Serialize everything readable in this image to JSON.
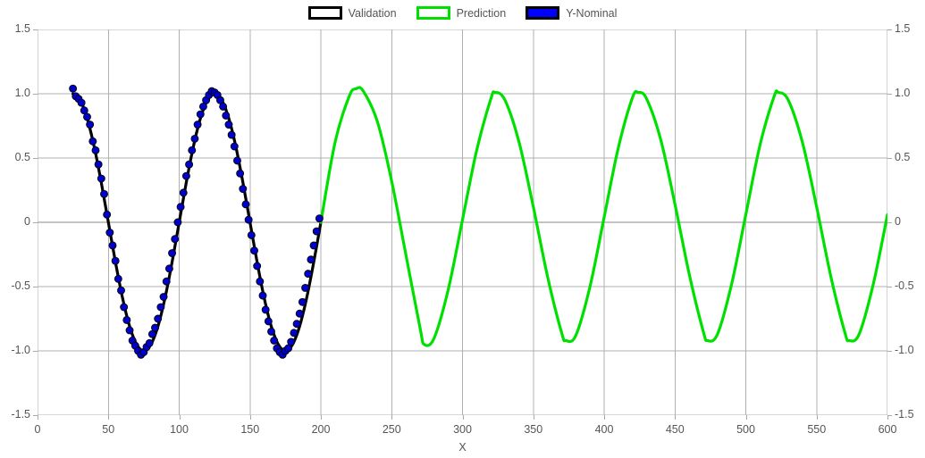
{
  "legend": {
    "position": "top-center",
    "entries": [
      {
        "label": "Validation",
        "swatch": "black-outline-box",
        "color": "#000000"
      },
      {
        "label": "Prediction",
        "swatch": "green-outline-box",
        "color": "#00e000"
      },
      {
        "label": "Y-Nominal",
        "swatch": "blue-filled-box",
        "color": "#0000ff"
      }
    ]
  },
  "axes": {
    "x": {
      "title": "X",
      "ticks": [
        0,
        50,
        100,
        150,
        200,
        250,
        300,
        350,
        400,
        450,
        500,
        550,
        600
      ],
      "tick_labels": [
        "0",
        "50",
        "100",
        "150",
        "200",
        "250",
        "300",
        "350",
        "400",
        "450",
        "500",
        "550",
        "600"
      ],
      "min": 0,
      "max": 600
    },
    "y_left": {
      "title": "",
      "ticks": [
        1.5,
        1.0,
        0.5,
        0,
        -0.5,
        -1.0,
        -1.5
      ],
      "tick_labels": [
        "1.5",
        "1.0",
        "0.5",
        "0",
        "-0.5",
        "-1.0",
        "-1.5"
      ],
      "min": -1.5,
      "max": 1.5
    },
    "y_right": {
      "title": "",
      "ticks": [
        1.5,
        1.0,
        0.5,
        0,
        -0.5,
        -1.0,
        -1.5
      ],
      "tick_labels": [
        "1.5",
        "1.0",
        "0.5",
        "0",
        "-0.5",
        "-1.0",
        "-1.5"
      ],
      "min": -1.5,
      "max": 1.5
    }
  },
  "chart_data": {
    "type": "line",
    "title": "",
    "xlabel": "X",
    "ylabel": "",
    "xlim": [
      0,
      600
    ],
    "ylim": [
      -1.5,
      1.5
    ],
    "grid": true,
    "legend_position": "top-center",
    "series": [
      {
        "name": "Validation",
        "type": "line",
        "color": "#000000",
        "linewidth": 3.2,
        "x": [
          25,
          30,
          35,
          40,
          45,
          50,
          55,
          60,
          65,
          70,
          75,
          80,
          85,
          90,
          95,
          100,
          105,
          110,
          115,
          120,
          125,
          130,
          135,
          140,
          145,
          150,
          155,
          160,
          165,
          170,
          175,
          180,
          185,
          190,
          195,
          200
        ],
        "y": [
          0.999,
          0.954,
          0.809,
          0.588,
          0.309,
          0.0,
          -0.309,
          -0.588,
          -0.809,
          -0.951,
          -1.0,
          -0.951,
          -0.809,
          -0.588,
          -0.309,
          0.0,
          0.309,
          0.588,
          0.809,
          0.951,
          1.0,
          0.951,
          0.809,
          0.588,
          0.309,
          0.0,
          -0.309,
          -0.588,
          -0.809,
          -0.951,
          -1.0,
          -0.951,
          -0.809,
          -0.588,
          -0.309,
          0.0
        ]
      },
      {
        "name": "Prediction",
        "type": "line",
        "color": "#00e000",
        "linewidth": 3.2,
        "x": [
          200,
          210,
          220,
          225,
          230,
          240,
          250,
          260,
          270,
          273,
          280,
          290,
          300,
          310,
          320,
          323,
          330,
          340,
          350,
          360,
          370,
          373,
          380,
          390,
          400,
          410,
          420,
          424,
          430,
          440,
          450,
          460,
          470,
          473,
          480,
          490,
          500,
          510,
          520,
          523,
          530,
          540,
          550,
          560,
          570,
          573,
          580,
          590,
          600
        ],
        "y": [
          0.0,
          0.62,
          0.98,
          1.04,
          1.02,
          0.78,
          0.32,
          -0.25,
          -0.82,
          -0.95,
          -0.9,
          -0.52,
          0.02,
          0.56,
          0.96,
          1.01,
          0.95,
          0.62,
          0.12,
          -0.42,
          -0.86,
          -0.92,
          -0.88,
          -0.5,
          0.04,
          0.58,
          0.97,
          1.01,
          0.96,
          0.64,
          0.14,
          -0.4,
          -0.85,
          -0.92,
          -0.87,
          -0.48,
          0.06,
          0.6,
          0.98,
          1.01,
          0.95,
          0.62,
          0.12,
          -0.42,
          -0.86,
          -0.92,
          -0.87,
          -0.48,
          0.06
        ]
      },
      {
        "name": "Y-Nominal",
        "type": "scatter",
        "color": "#0000ff",
        "marker": "circle",
        "marker_size": 6,
        "x": [
          25,
          27,
          29,
          31,
          33,
          35,
          37,
          39,
          41,
          43,
          45,
          47,
          49,
          51,
          53,
          55,
          57,
          59,
          61,
          63,
          65,
          67,
          69,
          71,
          73,
          75,
          77,
          79,
          81,
          83,
          85,
          87,
          89,
          91,
          93,
          95,
          97,
          99,
          101,
          103,
          105,
          107,
          109,
          111,
          113,
          115,
          117,
          119,
          121,
          123,
          125,
          127,
          129,
          131,
          133,
          135,
          137,
          139,
          141,
          143,
          145,
          147,
          149,
          151,
          153,
          155,
          157,
          159,
          161,
          163,
          165,
          167,
          169,
          171,
          173,
          175,
          177,
          179,
          181,
          183,
          185,
          187,
          189,
          191,
          193,
          195,
          197,
          199
        ],
        "y": [
          1.04,
          0.98,
          0.96,
          0.93,
          0.87,
          0.82,
          0.76,
          0.63,
          0.56,
          0.45,
          0.34,
          0.22,
          0.06,
          -0.08,
          -0.18,
          -0.3,
          -0.44,
          -0.53,
          -0.66,
          -0.76,
          -0.84,
          -0.92,
          -0.96,
          -1.0,
          -1.03,
          -1.01,
          -0.97,
          -0.94,
          -0.87,
          -0.82,
          -0.75,
          -0.66,
          -0.58,
          -0.46,
          -0.36,
          -0.24,
          -0.13,
          0.0,
          0.12,
          0.23,
          0.36,
          0.45,
          0.56,
          0.65,
          0.76,
          0.84,
          0.9,
          0.95,
          0.99,
          1.02,
          1.01,
          0.99,
          0.95,
          0.9,
          0.83,
          0.76,
          0.68,
          0.59,
          0.48,
          0.38,
          0.26,
          0.14,
          0.02,
          -0.1,
          -0.22,
          -0.34,
          -0.46,
          -0.57,
          -0.68,
          -0.77,
          -0.85,
          -0.92,
          -0.98,
          -1.01,
          -1.03,
          -1.0,
          -0.98,
          -0.93,
          -0.86,
          -0.79,
          -0.71,
          -0.62,
          -0.51,
          -0.4,
          -0.29,
          -0.18,
          -0.07,
          0.03
        ]
      }
    ]
  }
}
